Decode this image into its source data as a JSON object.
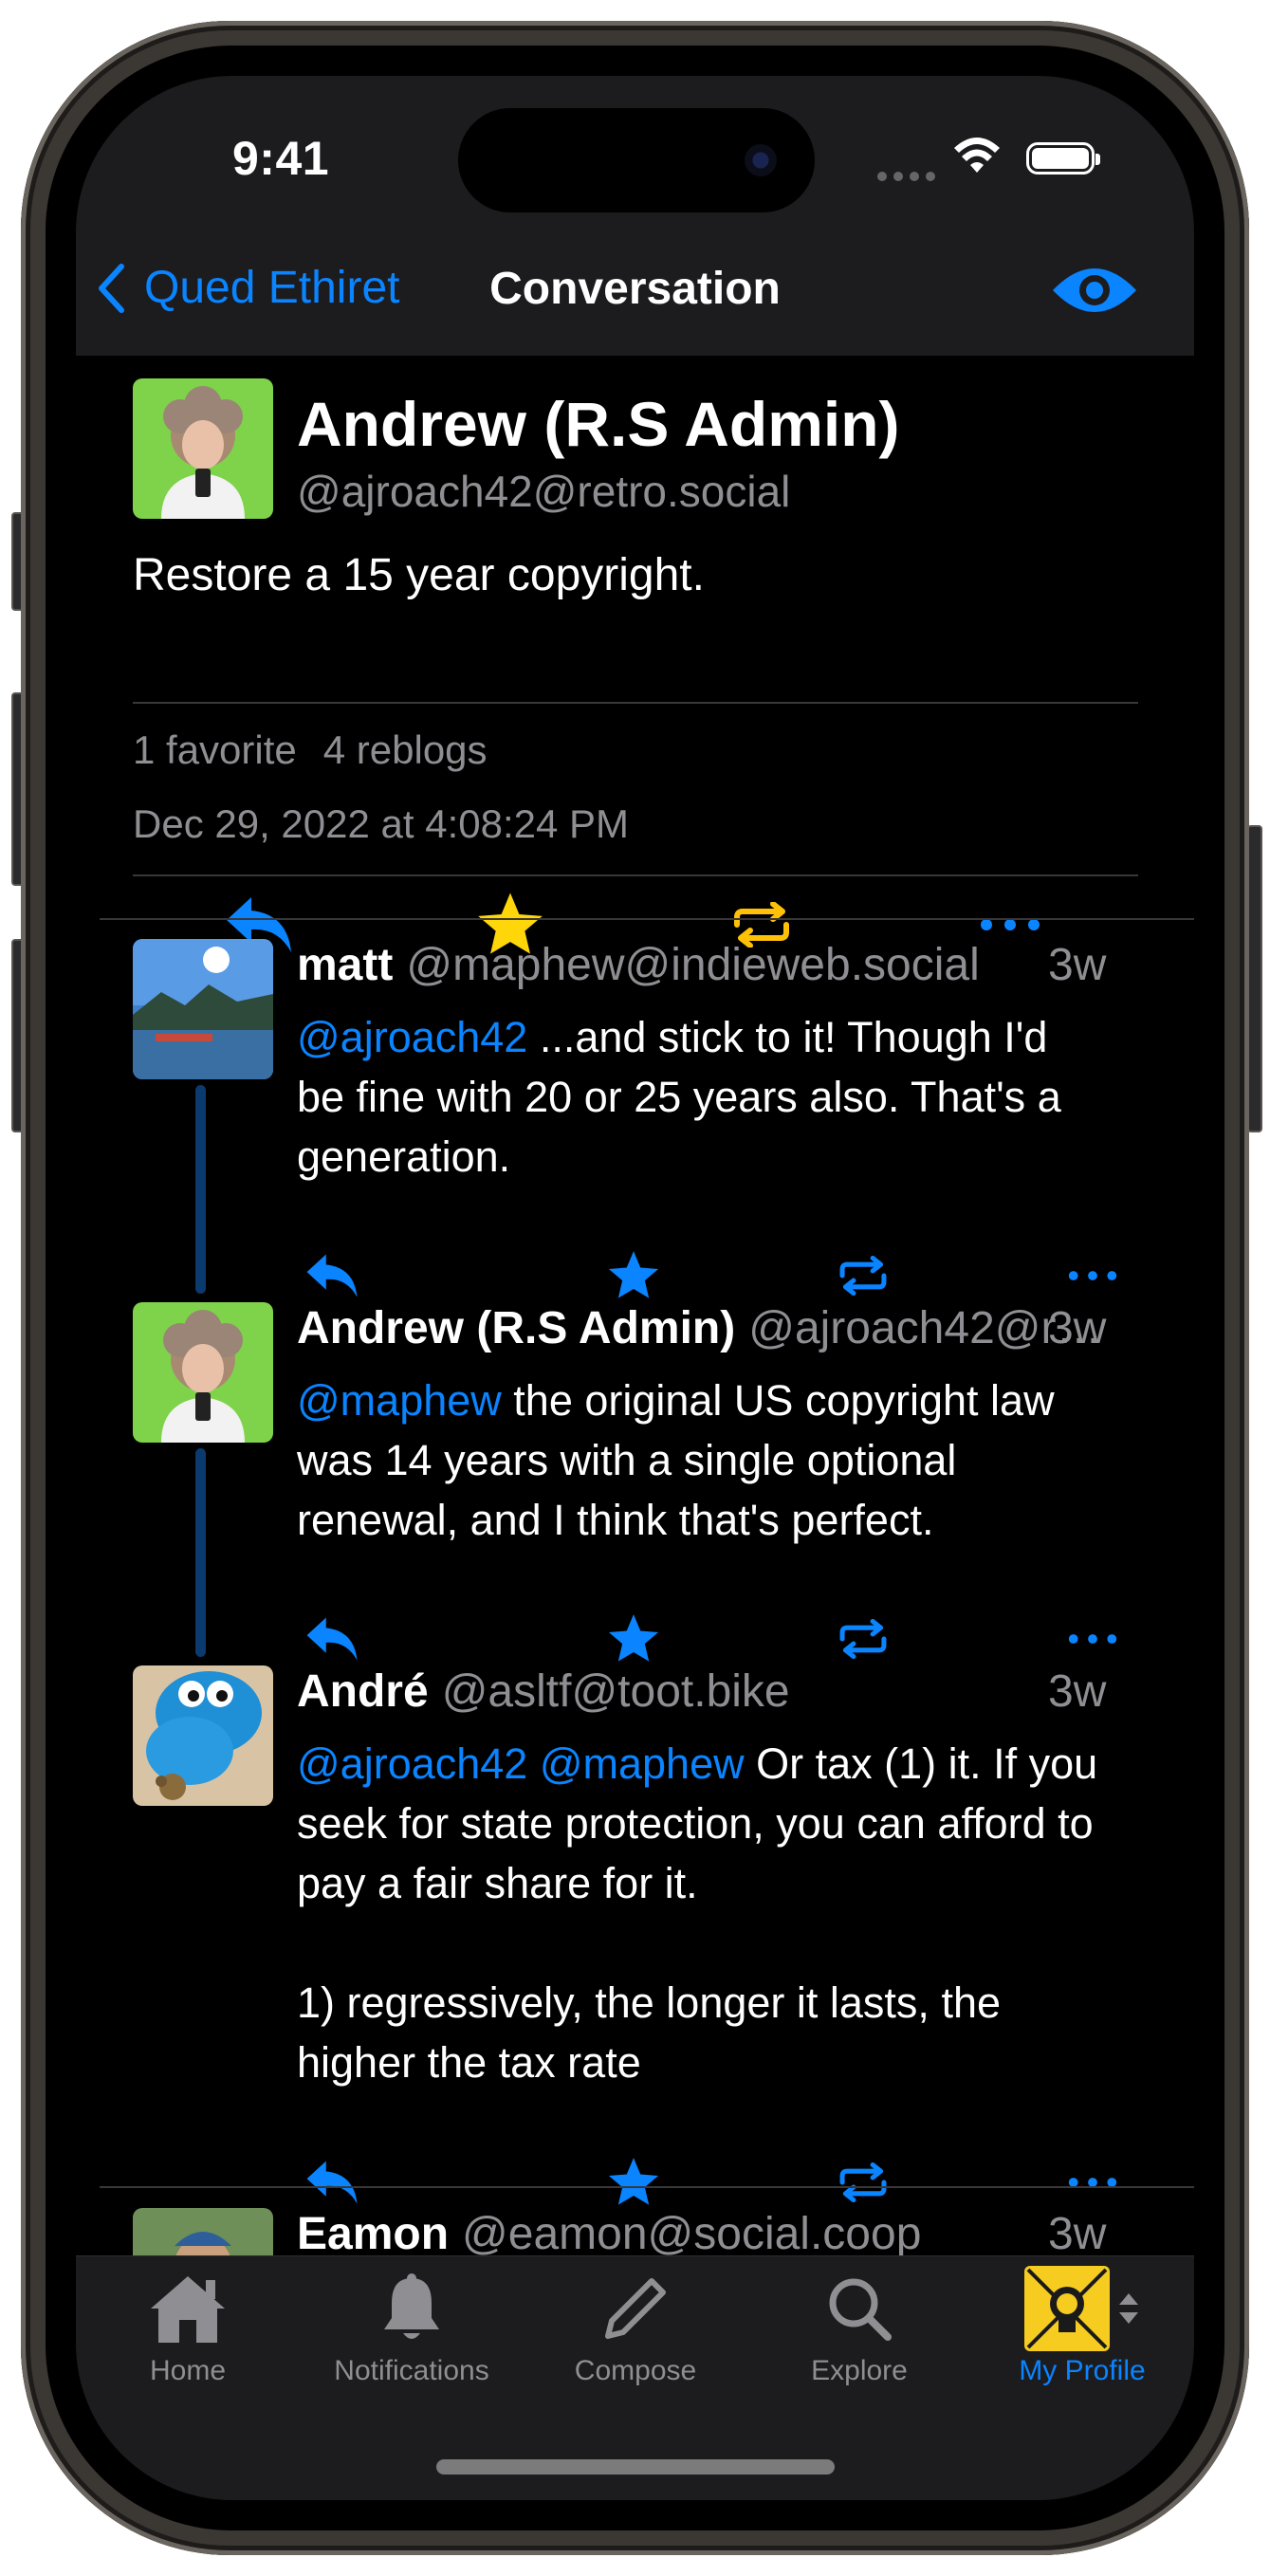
{
  "status_bar": {
    "time": "9:41"
  },
  "nav": {
    "back_label": "Qued Ethiret",
    "title": "Conversation"
  },
  "main_post": {
    "name": "Andrew (R.S Admin)",
    "handle": "@ajroach42@retro.social",
    "content": "Restore a 15 year copyright.",
    "favorites": "1 favorite",
    "reblogs": "4 reblogs",
    "date": "Dec 29, 2022 at 4:08:24 PM"
  },
  "replies": [
    {
      "name": "matt",
      "handle": "@maphew@indieweb.social",
      "time": "3w",
      "mention": "@ajroach42",
      "text": " ...and stick to it! Though I'd be fine with 20 or 25 years also. That's a generation."
    },
    {
      "name": "Andrew (R.S Admin)",
      "handle": "@ajroach42@retro.social",
      "time": "3w",
      "mention": "@maphew",
      "text": " the original US copyright law was 14 years with a single optional renewal, and I think that's perfect."
    },
    {
      "name": "André",
      "handle": "@asltf@toot.bike",
      "time": "3w",
      "mention": "@ajroach42 @maphew",
      "text": " Or tax (1) it. If you seek for state protection, you can afford to pay a fair share for it.\n\n1) regressively, the longer it lasts, the higher the tax rate"
    },
    {
      "name": "Eamon",
      "handle": "@eamon@social.coop",
      "time": "3w"
    }
  ],
  "tabbar": {
    "items": [
      {
        "label": "Home",
        "icon": "house-icon"
      },
      {
        "label": "Notifications",
        "icon": "bell-icon"
      },
      {
        "label": "Compose",
        "icon": "pencil-icon"
      },
      {
        "label": "Explore",
        "icon": "magnifier-icon"
      },
      {
        "label": "My Profile",
        "icon": "profile-avatar"
      }
    ]
  },
  "colors": {
    "accent": "#0a84ff",
    "favorite_active": "#ffd60a",
    "reblog_active": "#ffc107",
    "secondary_text": "#8e8e93",
    "bar_background": "#1c1c1e",
    "thread_line": "#0a3a6e"
  }
}
